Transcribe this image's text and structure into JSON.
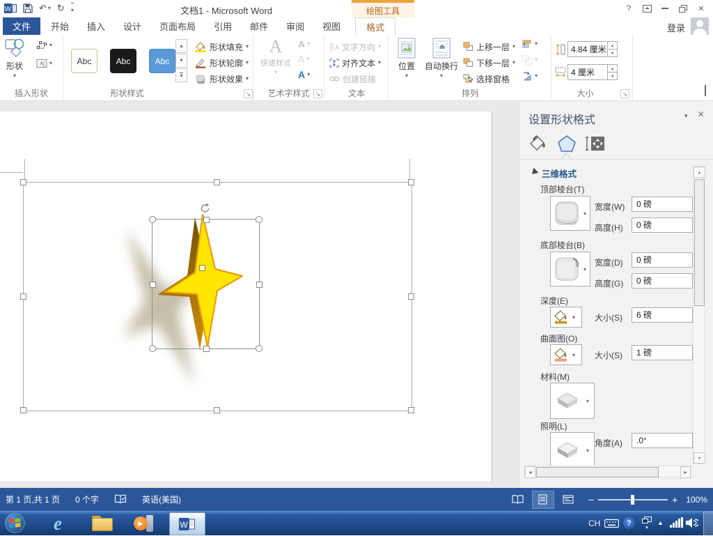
{
  "colors": {
    "word_blue": "#2B579A",
    "context_strip": "#F0A23C",
    "context_text": "#BC5E11",
    "pane_title": "#44546A",
    "section_blue": "#25598C",
    "star_fill": "#FFE600",
    "star_outline": "#EE9C0D",
    "status_bar": "#2B579A"
  },
  "icons": {
    "caret_down": "▾",
    "caret_up": "▴",
    "scroll_left": "◂",
    "scroll_right": "▸",
    "launcher": "↘",
    "help": "?",
    "close": "×",
    "undo": "↶",
    "redo": "↻",
    "zoom_minus": "−",
    "zoom_plus": "+",
    "tray_expand": "▲"
  },
  "title_bar": {
    "title": "文档1 - Microsoft Word",
    "context_header": "绘图工具",
    "sign_in": "登录"
  },
  "tabs": {
    "file": "文件",
    "items": [
      "开始",
      "插入",
      "设计",
      "页面布局",
      "引用",
      "邮件",
      "审阅",
      "视图"
    ],
    "context": "格式"
  },
  "ribbon": {
    "insert_shapes": {
      "button": "形状",
      "group": "插入形状"
    },
    "shape_styles": {
      "swatch": "Abc",
      "fill": "形状填充",
      "outline": "形状轮廓",
      "effects": "形状效果",
      "group": "形状样式"
    },
    "wordart": {
      "letter": "A",
      "quick_styles": "快速样式",
      "group": "艺术字样式"
    },
    "text": {
      "direction": "文字方向",
      "align": "对齐文本",
      "link": "创建链接",
      "group": "文本"
    },
    "arrange": {
      "position": "位置",
      "wrap": "自动换行",
      "forward": "上移一层",
      "backward": "下移一层",
      "selection_pane": "选择窗格",
      "group": "排列"
    },
    "size": {
      "height_value": "4.84 厘米",
      "width_value": "4 厘米",
      "group": "大小"
    }
  },
  "pane": {
    "title": "设置形状格式",
    "section": "三维格式",
    "top_bevel": {
      "label": "顶部棱台(T)",
      "w_label": "宽度(W)",
      "w_value": "0 磅",
      "h_label": "高度(H)",
      "h_value": "0 磅"
    },
    "bottom_bevel": {
      "label": "底部棱台(B)",
      "w_label": "宽度(D)",
      "w_value": "0 磅",
      "h_label": "高度(G)",
      "h_value": "0 磅"
    },
    "depth": {
      "label": "深度(E)",
      "s_label": "大小(S)",
      "s_value": "6 磅"
    },
    "contour": {
      "label": "曲面图(O)",
      "s_label": "大小(S)",
      "s_value": "1 磅"
    },
    "material": {
      "label": "材料(M)"
    },
    "lighting": {
      "label": "照明(L)",
      "a_label": "角度(A)",
      "a_value": ".0°"
    }
  },
  "status": {
    "page_info": "第 1 页,共 1 页",
    "word_count": "0 个字",
    "language": "英语(美国)",
    "zoom": "100%"
  },
  "taskbar": {
    "language": "CH"
  }
}
